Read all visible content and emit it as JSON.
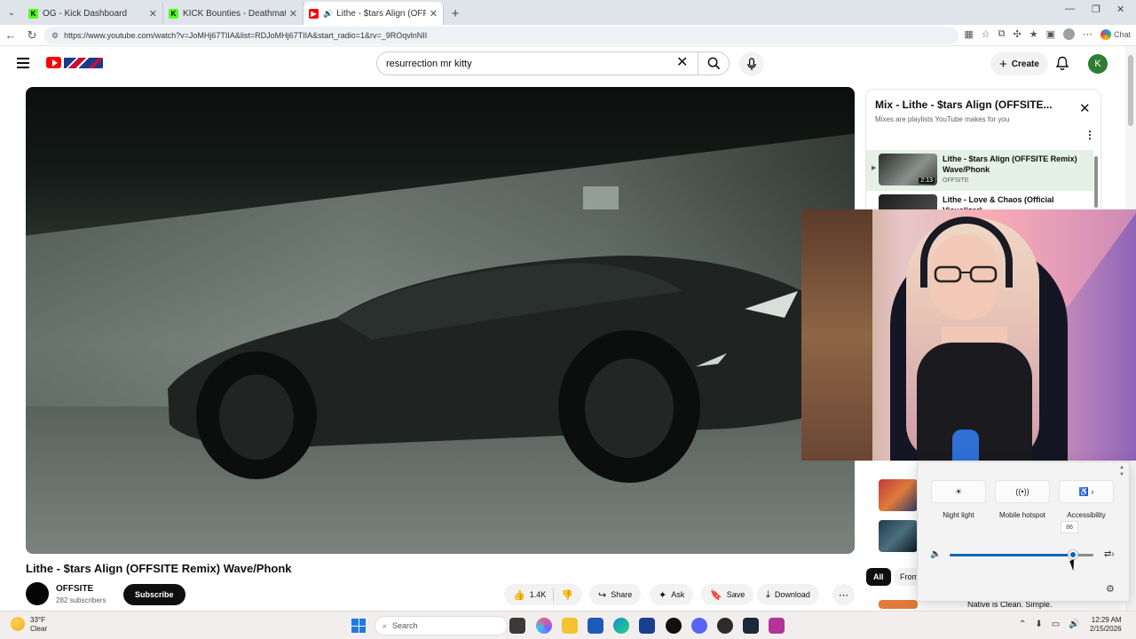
{
  "browser": {
    "tabs": [
      {
        "title": "OG - Kick Dashboard",
        "favicon_color": "#53fc18",
        "active": false
      },
      {
        "title": "KICK Bounties - Deathmatch Dom",
        "favicon_color": "#53fc18",
        "active": false
      },
      {
        "title": "Lithe - $tars Align (OFFSITE R",
        "favicon_color": "#ff0000",
        "active": true
      }
    ],
    "new_tab": "+",
    "url": "https://www.youtube.com/watch?v=JoMHj67TIIA&list=RDJoMHj67TIIA&start_radio=1&rv=_9ROqvlnNII",
    "chat_label": "Chat"
  },
  "youtube": {
    "search_query": "resurrection mr kitty",
    "create_label": "Create",
    "account_initial": "K"
  },
  "video": {
    "title": "Lithe - $tars Align (OFFSITE Remix) Wave/Phonk",
    "channel": "OFFSITE",
    "subscribers": "282 subscribers",
    "subscribe_label": "Subscribe",
    "actions": {
      "likes": "1.4K",
      "share": "Share",
      "ask": "Ask",
      "save": "Save",
      "download": "Download"
    }
  },
  "playlist": {
    "title": "Mix - Lithe - $tars Align (OFFSITE...",
    "subtitle": "Mixes are playlists YouTube makes for you",
    "items": [
      {
        "title": "Lithe - $tars Align (OFFSITE Remix) Wave/Phonk",
        "channel": "OFFSITE",
        "duration": "2:13"
      },
      {
        "title": "Lithe - Love & Chaos (Official Visualizer)",
        "channel": "",
        "duration": ""
      }
    ]
  },
  "chips": {
    "all": "All",
    "from": "From"
  },
  "side_text": "Native is Clean. Simple.",
  "quick_settings": {
    "tiles": [
      {
        "label": "Night light",
        "icon": "brightness-icon"
      },
      {
        "label": "Mobile hotspot",
        "icon": "hotspot-icon"
      },
      {
        "label": "Accessibility",
        "icon": "accessibility-icon"
      }
    ],
    "volume": 86,
    "volume_label": "86"
  },
  "taskbar": {
    "temperature": "33°F",
    "condition": "Clear",
    "search_placeholder": "Search",
    "time": "12:29 AM",
    "date": "2/15/2026"
  }
}
